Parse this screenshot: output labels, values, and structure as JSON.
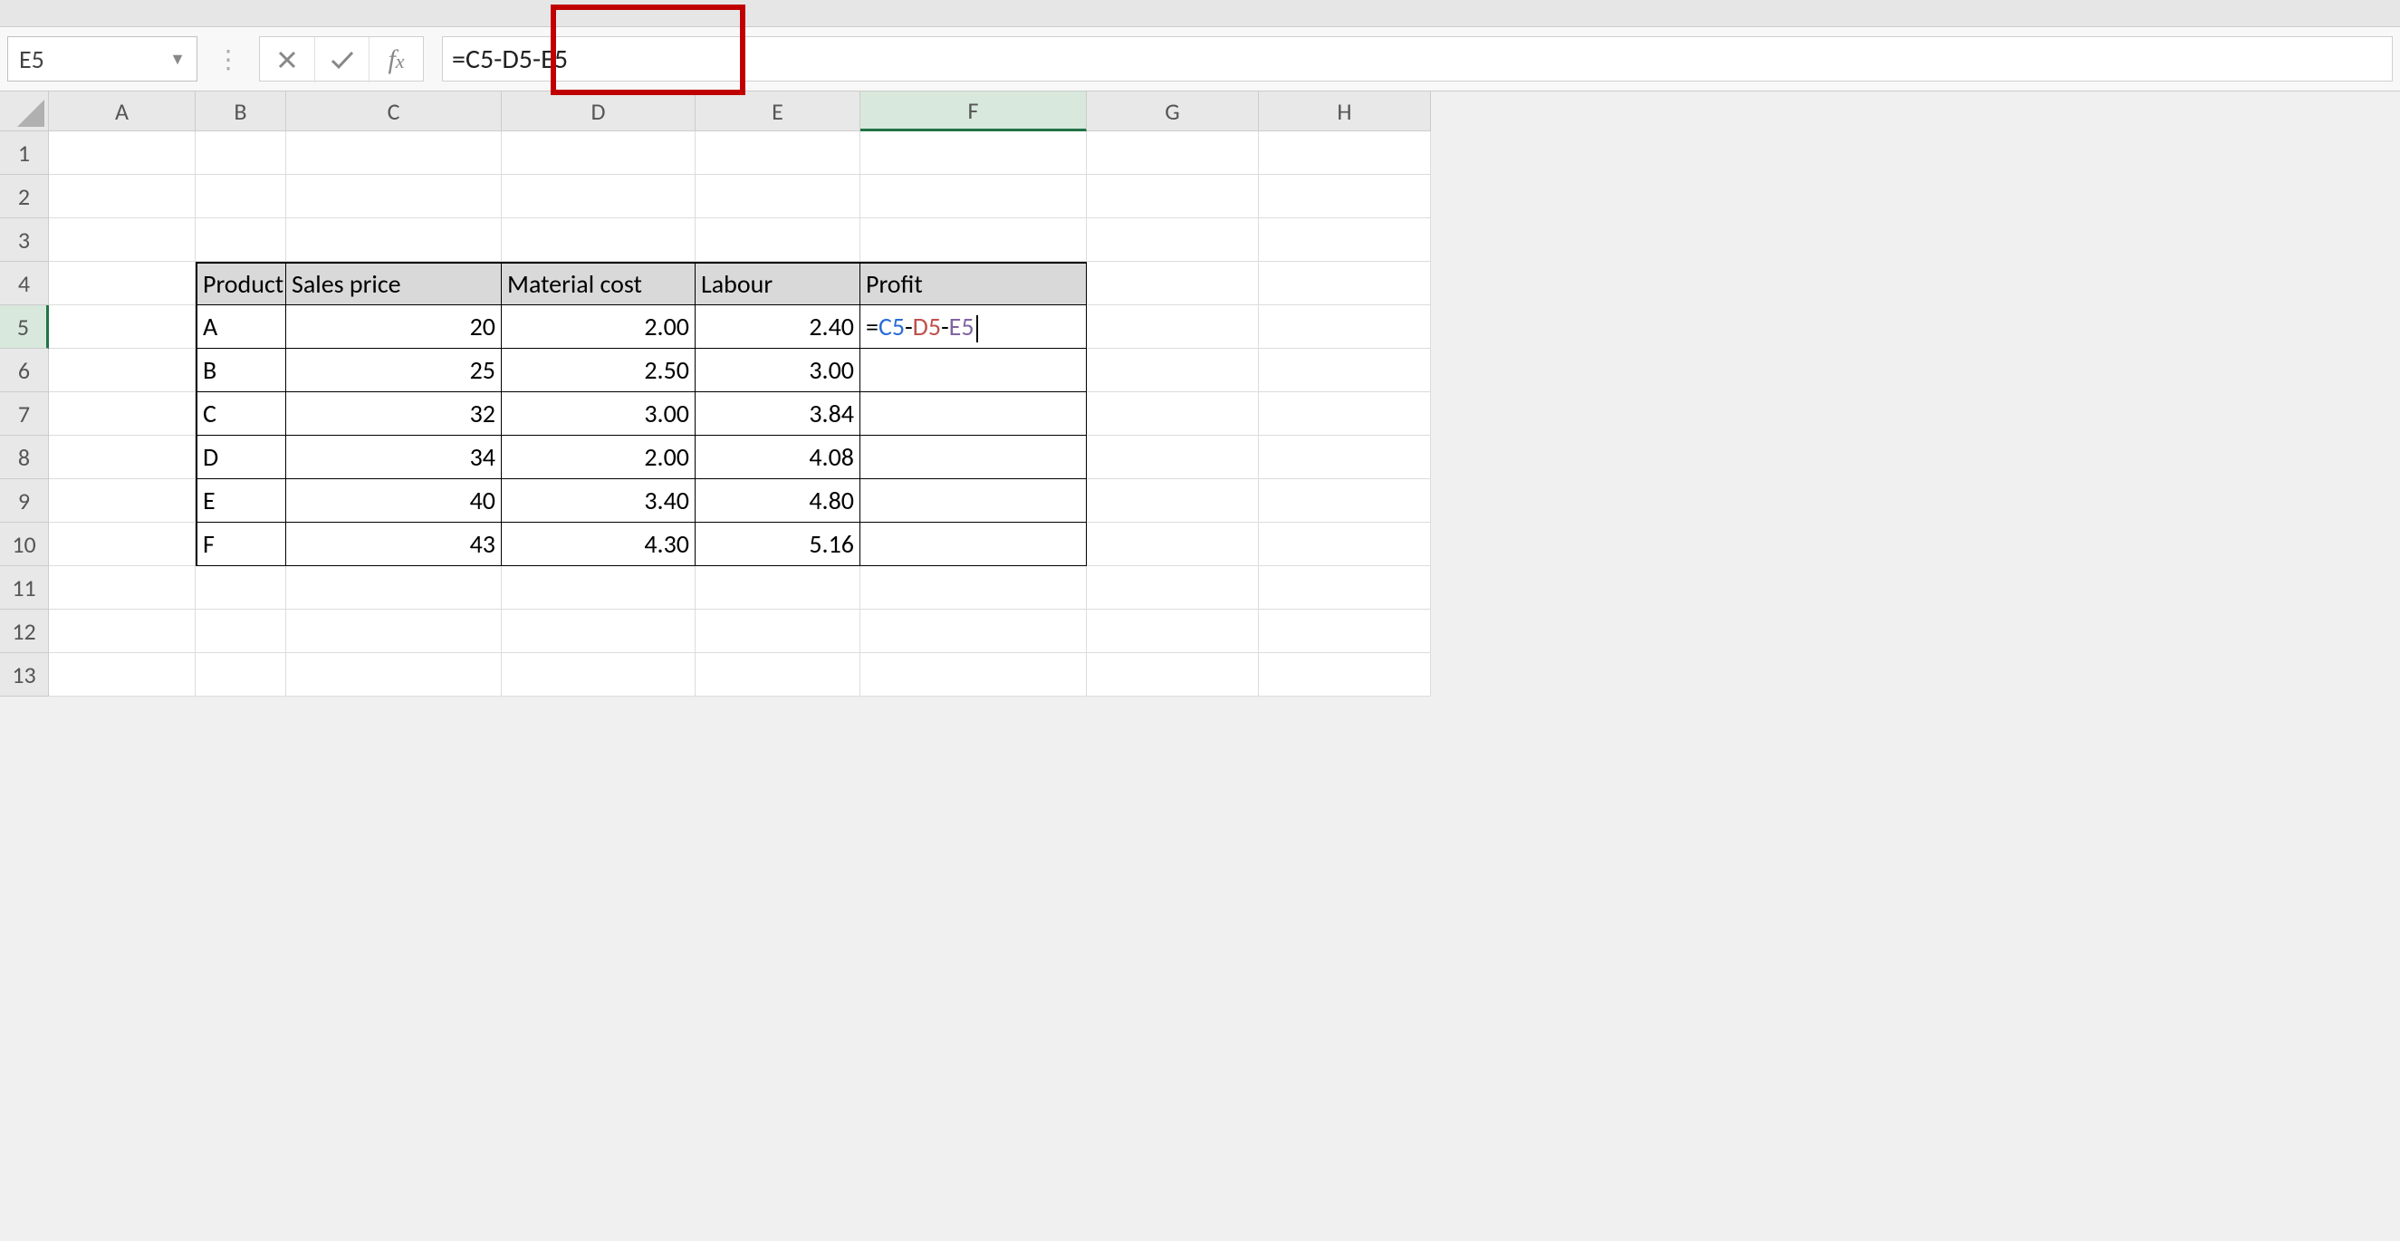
{
  "name_box": "E5",
  "formula_bar": "=C5-D5-E5",
  "columns": [
    "A",
    "B",
    "C",
    "D",
    "E",
    "F",
    "G",
    "H"
  ],
  "active_col": "F",
  "active_row": 5,
  "row_count": 13,
  "table": {
    "headers": {
      "B": "Product",
      "C": "Sales price",
      "D": "Material cost",
      "E": "Labour",
      "F": "Profit"
    },
    "rows": [
      {
        "B": "A",
        "C": "20",
        "D": "2.00",
        "E": "2.40"
      },
      {
        "B": "B",
        "C": "25",
        "D": "2.50",
        "E": "3.00"
      },
      {
        "B": "C",
        "C": "32",
        "D": "3.00",
        "E": "3.84"
      },
      {
        "B": "D",
        "C": "34",
        "D": "2.00",
        "E": "4.08"
      },
      {
        "B": "E",
        "C": "40",
        "D": "3.40",
        "E": "4.80"
      },
      {
        "B": "F",
        "C": "43",
        "D": "4.30",
        "E": "5.16"
      }
    ]
  },
  "cell_edit": {
    "eq": "=",
    "r1": "C5",
    "r2": "D5",
    "r3": "E5",
    "op": "-"
  },
  "chart_data": {
    "type": "table",
    "title": "",
    "columns": [
      "Product",
      "Sales price",
      "Material cost",
      "Labour",
      "Profit"
    ],
    "rows": [
      [
        "A",
        20,
        2.0,
        2.4,
        null
      ],
      [
        "B",
        25,
        2.5,
        3.0,
        null
      ],
      [
        "C",
        32,
        3.0,
        3.84,
        null
      ],
      [
        "D",
        34,
        2.0,
        4.08,
        null
      ],
      [
        "E",
        40,
        3.4,
        4.8,
        null
      ],
      [
        "F",
        43,
        4.3,
        5.16,
        null
      ]
    ],
    "formula_in_F5": "=C5-D5-E5"
  }
}
